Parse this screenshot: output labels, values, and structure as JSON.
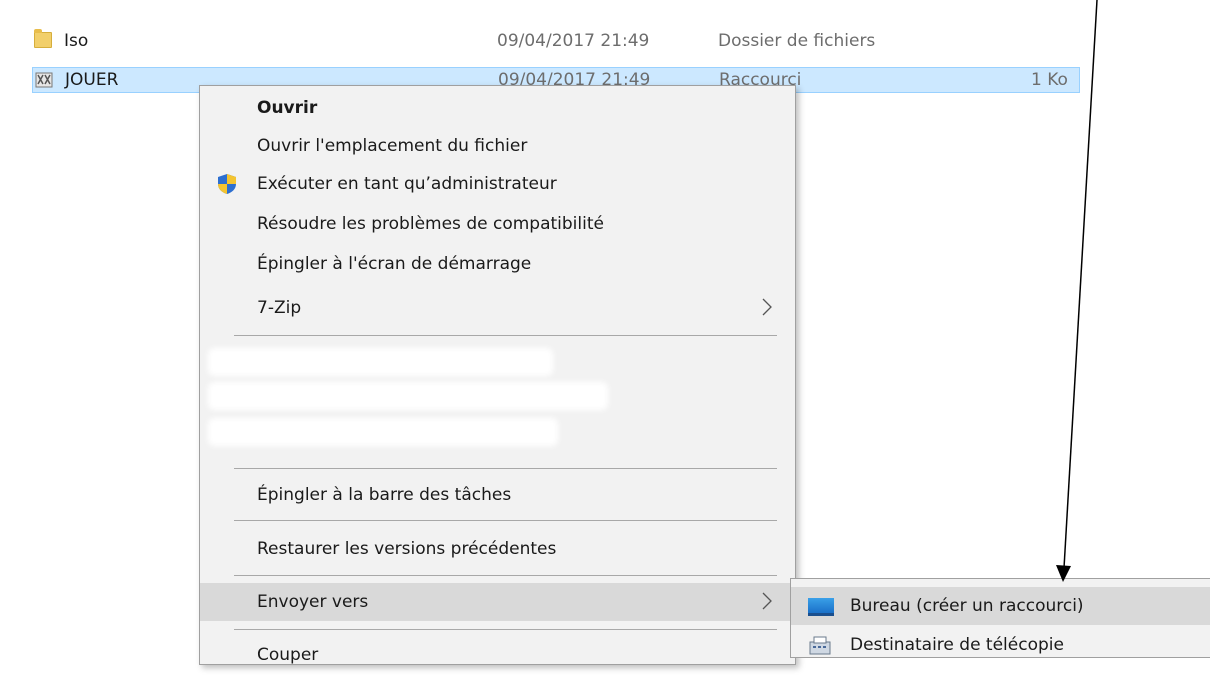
{
  "file_list": [
    {
      "name": "Iso",
      "date": "09/04/2017 21:49",
      "type": "Dossier de fichiers",
      "size": ""
    },
    {
      "name": "JOUER",
      "date": "09/04/2017 21:49",
      "type": "Raccourci",
      "size": "1 Ko"
    }
  ],
  "context_menu": {
    "open": "Ouvrir",
    "open_location": "Ouvrir l'emplacement du fichier",
    "run_as_admin": "Exécuter en tant qu’administrateur",
    "troubleshoot": "Résoudre les problèmes de compatibilité",
    "pin_start": "Épingler à l'écran de démarrage",
    "seven_zip": "7-Zip",
    "pin_taskbar": "Épingler à la barre des tâches",
    "restore_versions": "Restaurer les versions précédentes",
    "send_to": "Envoyer vers",
    "cut": "Couper"
  },
  "send_to_submenu": {
    "desktop": "Bureau (créer un raccourci)",
    "fax": "Destinataire de télécopie"
  },
  "colors": {
    "selection": "#cce8ff",
    "menu_bg": "#f2f2f2",
    "highlight": "#d9d9d9"
  }
}
